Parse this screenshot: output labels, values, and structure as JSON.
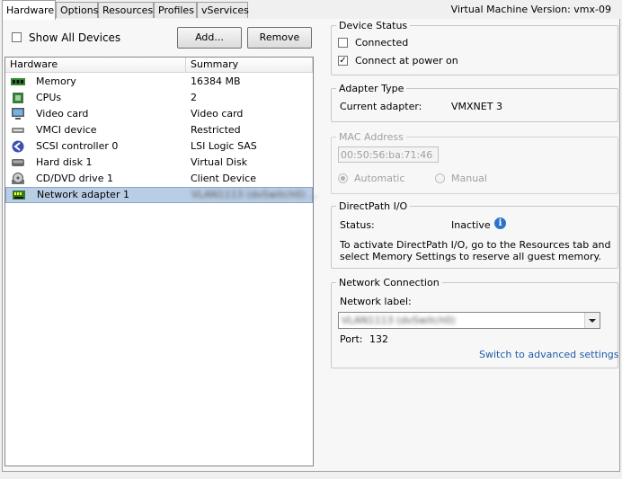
{
  "tabs": [
    "Hardware",
    "Options",
    "Resources",
    "Profiles",
    "vServices"
  ],
  "vm_version": "Virtual Machine Version: vmx-09",
  "show_all_devices": "Show All Devices",
  "add_button": "Add...",
  "remove_button": "Remove",
  "columns": {
    "hardware": "Hardware",
    "summary": "Summary"
  },
  "devices": [
    {
      "name": "Memory",
      "summary": "16384 MB",
      "icon": "memory-icon"
    },
    {
      "name": "CPUs",
      "summary": "2",
      "icon": "cpu-icon"
    },
    {
      "name": "Video card",
      "summary": "Video card",
      "icon": "monitor-icon"
    },
    {
      "name": "VMCI device",
      "summary": "Restricted",
      "icon": "vmci-icon"
    },
    {
      "name": "SCSI controller 0",
      "summary": "LSI Logic SAS",
      "icon": "scsi-icon"
    },
    {
      "name": "Hard disk 1",
      "summary": "Virtual Disk",
      "icon": "harddisk-icon"
    },
    {
      "name": "CD/DVD drive 1",
      "summary": "Client Device",
      "icon": "cdrom-icon"
    },
    {
      "name": "Network adapter 1",
      "summary": "VLAN1113 (dvSwitch0) ...",
      "icon": "network-icon"
    }
  ],
  "device_status": {
    "legend": "Device Status",
    "connected": "Connected",
    "connect_at_power_on": "Connect at power on"
  },
  "adapter_type": {
    "legend": "Adapter Type",
    "label": "Current adapter:",
    "value": "VMXNET 3"
  },
  "mac": {
    "legend": "MAC Address",
    "value": "00:50:56:ba:71:46",
    "automatic": "Automatic",
    "manual": "Manual"
  },
  "directpath": {
    "legend": "DirectPath I/O",
    "status_label": "Status:",
    "status_value": "Inactive",
    "info_line1": "To activate DirectPath I/O, go to the Resources tab and",
    "info_line2": "select Memory Settings to reserve all guest memory."
  },
  "network": {
    "legend": "Network Connection",
    "label": "Network label:",
    "selected": "VLAN1113 (dvSwitch0)",
    "port_label": "Port:",
    "port_value": "132",
    "advanced_link": "Switch to advanced settings"
  },
  "colors": {
    "selection": "#b9cde5",
    "link": "#1f5ca8",
    "info": "#2a73c9"
  }
}
